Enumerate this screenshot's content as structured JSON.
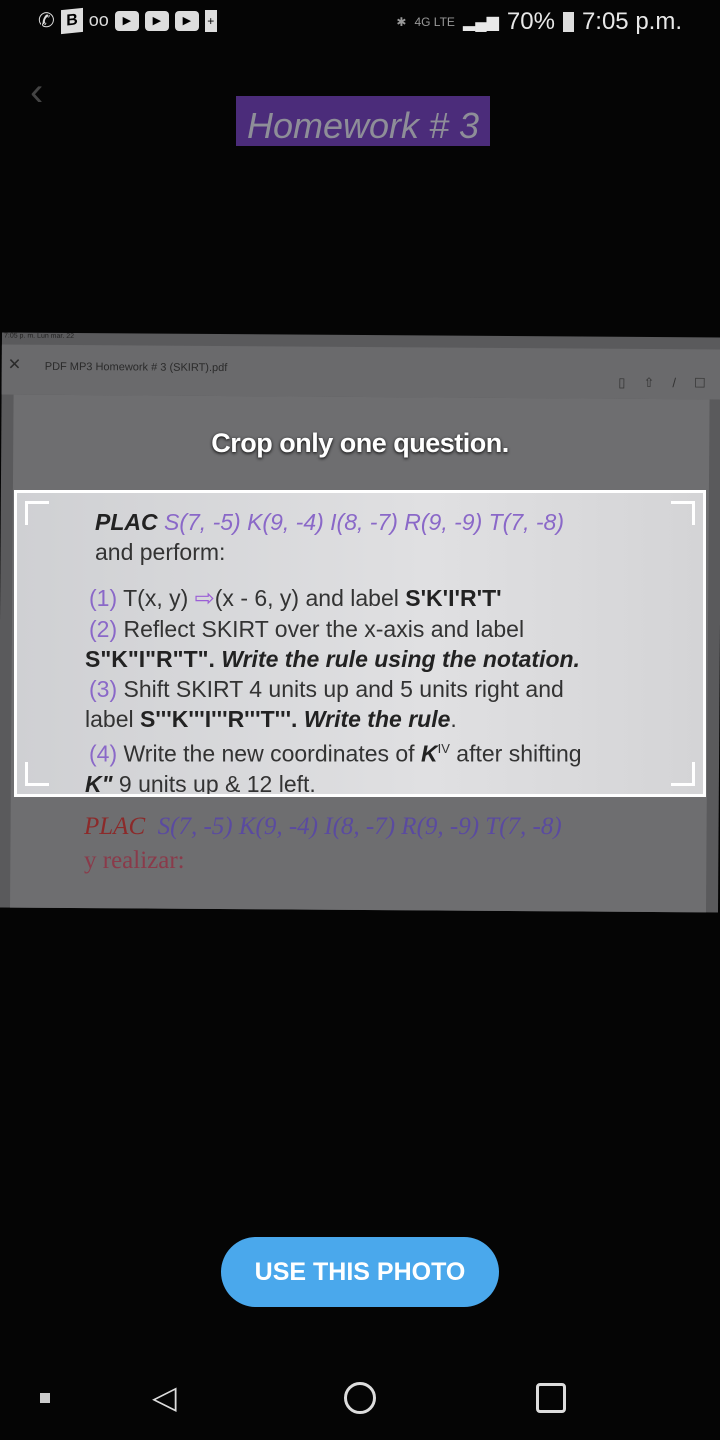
{
  "status_bar": {
    "battery": "70%",
    "time": "7:05 p.m.",
    "network": "4G LTE",
    "left_icons": [
      "phone-icon",
      "b-app-icon",
      "voicemail-icon",
      "play-icon",
      "play-icon",
      "play-icon",
      "battery-saver-icon"
    ]
  },
  "photo": {
    "tablet_status": "7:05 p. m.   Lun mar. 22",
    "pdf_title": "PDF MP3 Homework # 3 (SKIRT).pdf",
    "pdf_heading": "Homework # 3",
    "question": {
      "intro_bold": "PLAC",
      "points": "S(7, -5) K(9, -4) I(8, -7) R(9, -9) T(7, -8)",
      "intro_rest": "and perform:",
      "q1_num": "(1)",
      "q1_a": "T(x, y)",
      "q1_b": "(x - 6, y) and label",
      "q1_label": "S'K'I'R'T'",
      "q2_num": "(2)",
      "q2_a": "Reflect SKIRT over the x-axis and label",
      "q2_label": "S\"K\"I\"R\"T\".",
      "q2_rule": "Write the rule using the notation.",
      "q3_num": "(3)",
      "q3_a": "Shift SKIRT 4 units up and 5 units right and",
      "q3_b": "label",
      "q3_label": "S'''K'''I'''R'''T'''.",
      "q3_rule": "Write the rule",
      "q4_num": "(4)",
      "q4_a": "Write the new coordinates of",
      "q4_k": "K",
      "q4_sup": "IV",
      "q4_b": "after shifting",
      "q4_k2": "K\"",
      "q4_c": "9 units up & 12 left."
    },
    "spanish": {
      "plac": "PLAC",
      "points": "S(7, -5) K(9, -4) I(8, -7) R(9, -9) T(7, -8)",
      "line2": "y realizar:"
    }
  },
  "hint": "Crop only one question.",
  "use_button": "USE THIS PHOTO",
  "colors": {
    "accent": "#4aa8ec",
    "purple": "#8a68c8"
  }
}
